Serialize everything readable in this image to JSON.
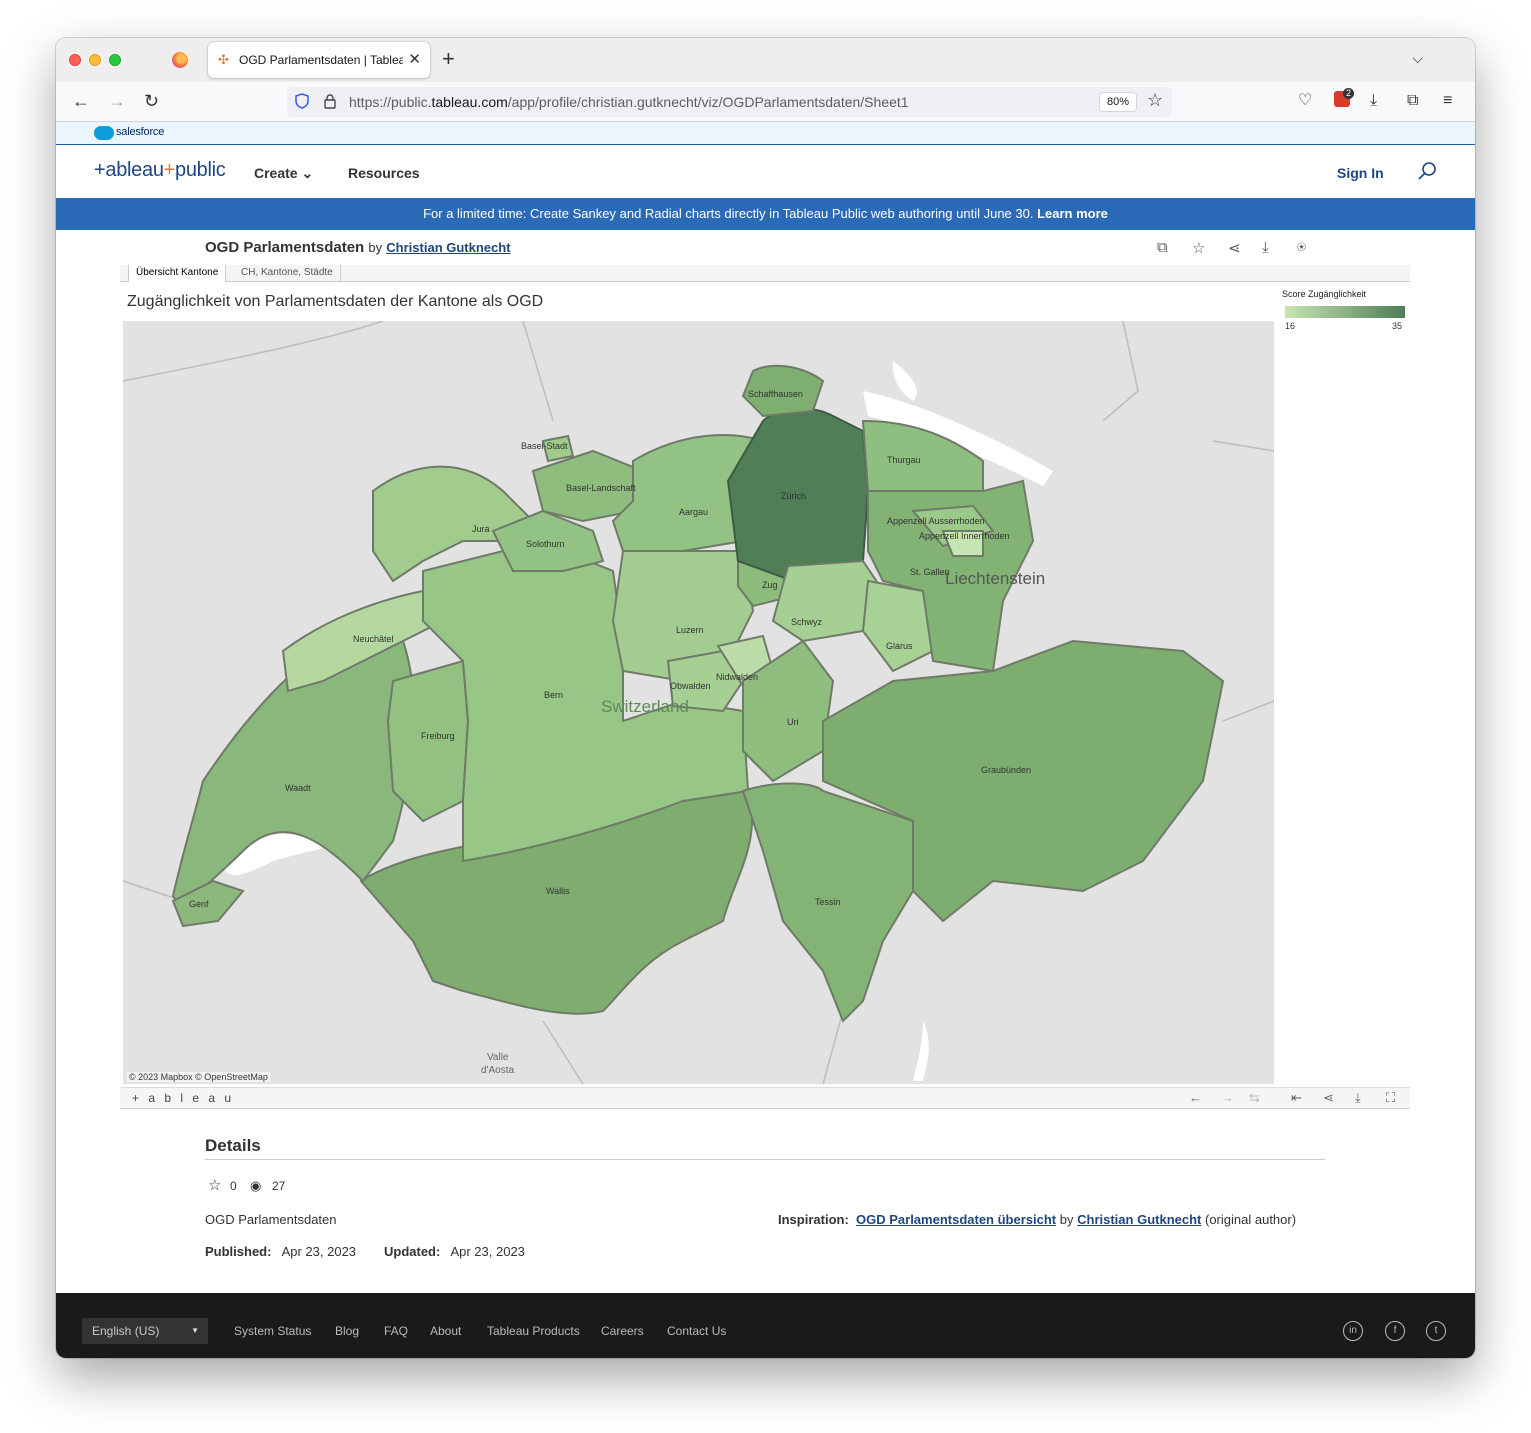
{
  "browser": {
    "tab_title": "OGD Parlamentsdaten | Tableau",
    "url_prefix": "https://public.",
    "url_domain": "tableau.com",
    "url_path": "/app/profile/christian.gutknecht/viz/OGDParlamentsdaten/Sheet1",
    "zoom": "80%",
    "ext_count": "2"
  },
  "salesforce": {
    "label": "salesforce"
  },
  "header": {
    "logo_left": "+ableau",
    "logo_plus": "+",
    "logo_right": "public",
    "nav": [
      "Create",
      "Resources"
    ],
    "sign_in": "Sign In"
  },
  "promo": {
    "text": "For a limited time: Create Sankey and Radial charts directly in Tableau Public web authoring until June 30.",
    "link": "Learn more"
  },
  "viz": {
    "title": "OGD Parlamentsdaten",
    "by": "by",
    "author": "Christian Gutknecht",
    "tabs": [
      "Übersicht Kantone",
      "CH, Kantone, Städte"
    ],
    "sheet_title": "Zugänglichkeit von Parlamentsdaten der Kantone als OGD",
    "legend": {
      "title": "Score Zugänglichkeit",
      "min": "16",
      "max": "35",
      "color_min": "#c6e5b2",
      "color_max": "#4f7e57"
    },
    "map_labels": {
      "schaffhausen": "Schaffhausen",
      "basel_stadt": "Basel-Stadt",
      "basel_land": "Basel-Landschaft",
      "thurgau": "Thurgau",
      "zuerich": "Zürich",
      "aargau": "Aargau",
      "jura": "Jura",
      "appenzell_a": "Appenzell Ausserrhoden",
      "appenzell_i": "Appenzell Innerrhoden",
      "solothurn": "Solothurn",
      "zug": "Zug",
      "st_gallen": "St. Gallen",
      "liechtenstein": "Liechtenstein",
      "neuchatel": "Neuchâtel",
      "schwyz": "Schwyz",
      "luzern": "Luzern",
      "glarus": "Glarus",
      "nidwalden": "Nidwalden",
      "obwalden": "Obwalden",
      "bern": "Bern",
      "switzerland": "Switzerland",
      "uri": "Uri",
      "freiburg": "Freiburg",
      "graubuenden": "Graubünden",
      "waadt": "Waadt",
      "wallis": "Wallis",
      "tessin": "Tessin",
      "genf": "Genf",
      "valle1": "Valle",
      "valle2": "d'Aosta"
    },
    "attribution": "© 2023 Mapbox  © OpenStreetMap",
    "toolbar_logo": "+ a b l e a u"
  },
  "details": {
    "heading": "Details",
    "favorites": "0",
    "views": "27",
    "description": "OGD Parlamentsdaten",
    "inspiration_label": "Inspiration:",
    "inspiration_link": "OGD Parlamentsdaten übersicht",
    "inspiration_by": "by",
    "inspiration_author": "Christian Gutknecht",
    "inspiration_suffix": "(original author)",
    "published_label": "Published:",
    "published": "Apr 23, 2023",
    "updated_label": "Updated:",
    "updated": "Apr 23, 2023"
  },
  "footer": {
    "language": "English (US)",
    "links": [
      "System Status",
      "Blog",
      "FAQ",
      "About",
      "Tableau Products",
      "Careers",
      "Contact Us"
    ],
    "social": [
      "in",
      "f",
      "t"
    ]
  }
}
